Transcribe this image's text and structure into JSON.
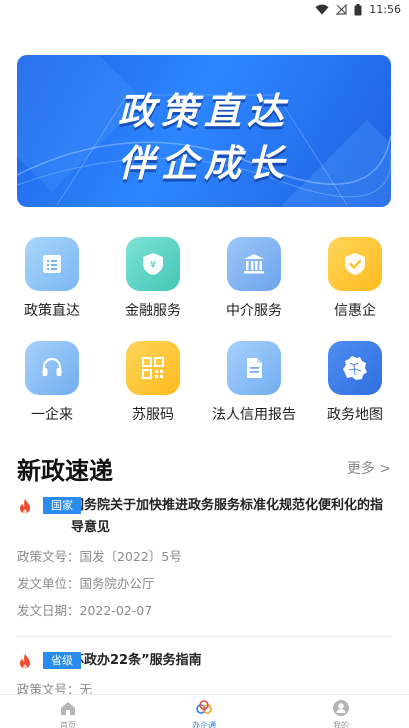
{
  "status_bar": {
    "time": "11:56"
  },
  "banner": {
    "line1": "政策直达",
    "line2": "伴企成长"
  },
  "services": [
    {
      "label": "政策直达",
      "icon": "policy-list-icon",
      "color": "#8cc4f5"
    },
    {
      "label": "金融服务",
      "icon": "finance-shield-icon",
      "color": "#5fd4c4"
    },
    {
      "label": "中介服务",
      "icon": "bank-building-icon",
      "color": "#7fb2f2"
    },
    {
      "label": "信惠企",
      "icon": "check-shield-icon",
      "color": "#ffc83a"
    },
    {
      "label": "一企来",
      "icon": "headset-icon",
      "color": "#7fb8f5"
    },
    {
      "label": "苏服码",
      "icon": "qr-code-icon",
      "color": "#ffc83a"
    },
    {
      "label": "法人信用报告",
      "icon": "document-icon",
      "color": "#7fb8f5"
    },
    {
      "label": "政务地图",
      "icon": "map-region-icon",
      "color": "#3a7be8"
    }
  ],
  "news_section": {
    "title": "新政速递",
    "more": "更多 >"
  },
  "news": [
    {
      "tag": "国家",
      "title": "国务院关于加快推进政务服务标准化规范化便利化的指导意见",
      "doc_no": "政策文号：国发〔2022〕5号",
      "issuer": "发文单位：国务院办公厅",
      "date": "发文日期：2022-02-07"
    },
    {
      "tag": "省级",
      "title": "苏政办22条”服务指南",
      "doc_no": "政策文号：无"
    }
  ],
  "bottom_nav": [
    {
      "label": "首页",
      "icon": "home-icon"
    },
    {
      "label": "办企通",
      "icon": "rings-logo-icon"
    },
    {
      "label": "我的",
      "icon": "profile-icon"
    }
  ]
}
